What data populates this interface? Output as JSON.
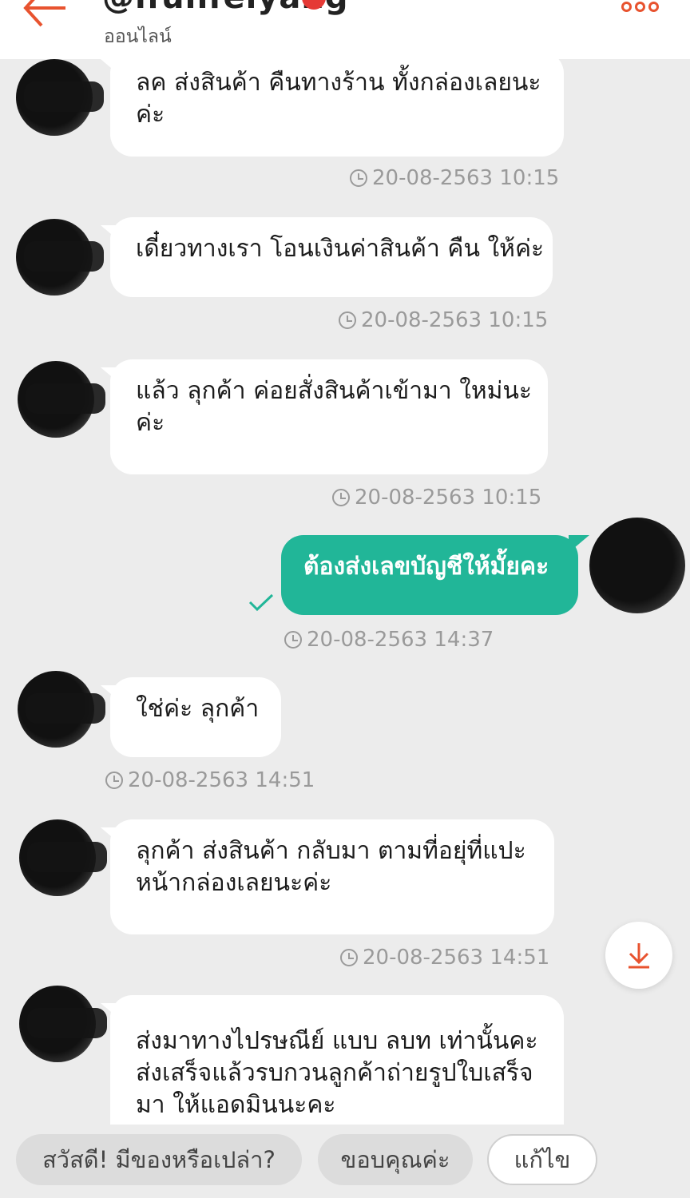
{
  "header": {
    "shop_name": "@ifunfeiyang",
    "status": "ออนไลน์"
  },
  "messages": [
    {
      "side": "shop",
      "lines": [
        "ลค ส่งสินค้า คืนทางร้าน ทั้งกล่องเลยนะ",
        "ค่ะ"
      ],
      "time": "20-08-2563 10:15"
    },
    {
      "side": "shop",
      "lines": [
        "เดี๋ยวทางเรา โอนเงินค่าสินค้า คืน ให้ค่ะ"
      ],
      "time": "20-08-2563 10:15"
    },
    {
      "side": "shop",
      "lines": [
        "แล้ว ลุกค้า ค่อยสั่งสินค้าเข้ามา ใหม่นะ",
        "ค่ะ"
      ],
      "time": "20-08-2563 10:15"
    },
    {
      "side": "me",
      "lines": [
        "ต้องส่งเลขบัญชีให้มั้ยคะ"
      ],
      "time": "20-08-2563 14:37",
      "read": true
    },
    {
      "side": "shop",
      "lines": [
        "ใช่ค่ะ ลุกค้า"
      ],
      "time": "20-08-2563 14:51"
    },
    {
      "side": "shop",
      "lines": [
        "ลุกค้า ส่งสินค้า กลับมา ตามที่อยุ่ที่แปะ",
        "หน้ากล่องเลยนะค่ะ"
      ],
      "time": "20-08-2563 14:51"
    },
    {
      "side": "shop",
      "lines": [
        "ส่งมาทางไปรษณีย์ แบบ ลบท เท่านั้นคะ",
        "ส่งเสร็จแล้วรบกวนลูกค้าถ่ายรูปใบเสร็จ",
        "มา ให้แอดมินนะคะ"
      ]
    }
  ],
  "quick_replies": [
    "สวัสดี! มีของหรือเปล่า?",
    "ขอบคุณค่ะ",
    "แก้ไข"
  ],
  "colors": {
    "accent": "#e8532f",
    "my_bubble": "#21b698",
    "background": "#ececec"
  }
}
